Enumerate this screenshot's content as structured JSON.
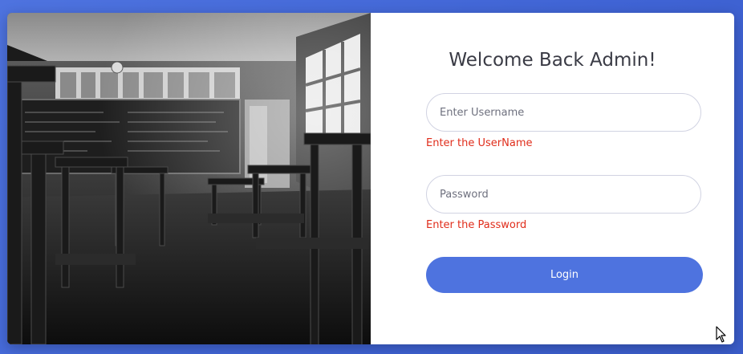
{
  "login": {
    "title": "Welcome Back Admin!",
    "username": {
      "placeholder": "Enter Username",
      "value": "",
      "error": "Enter the UserName"
    },
    "password": {
      "placeholder": "Password",
      "value": "",
      "error": "Enter the Password"
    },
    "submit_label": "Login"
  },
  "colors": {
    "background": "#4e73df",
    "button": "#4e73df",
    "error": "#e02d1b",
    "title": "#3a3b45"
  },
  "image": {
    "subject": "classroom-photo",
    "style": "black-and-white"
  }
}
